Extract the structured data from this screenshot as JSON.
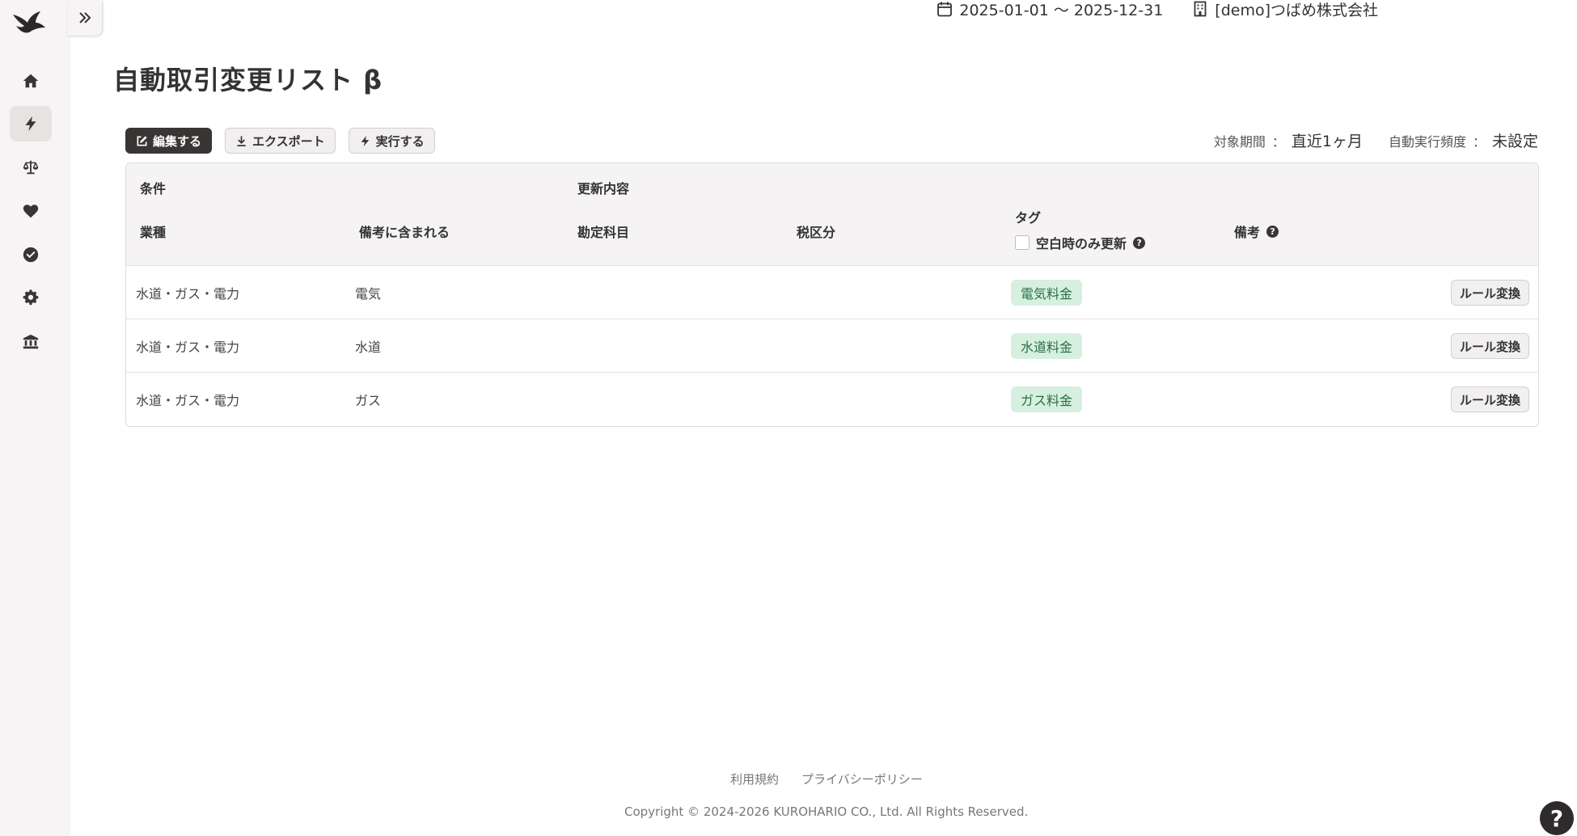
{
  "app": {
    "logo_icon": "swallow-bird-logo"
  },
  "sidebar": {
    "items": [
      {
        "name": "home",
        "icon": "home-icon",
        "active": false
      },
      {
        "name": "auto-rules",
        "icon": "lightning-icon",
        "active": true
      },
      {
        "name": "balance",
        "icon": "scale-icon",
        "active": false
      },
      {
        "name": "favorites",
        "icon": "heart-icon",
        "active": false
      },
      {
        "name": "check",
        "icon": "check-circle-icon",
        "active": false
      },
      {
        "name": "settings",
        "icon": "gear-icon",
        "active": false
      },
      {
        "name": "bank",
        "icon": "bank-icon",
        "active": false
      }
    ],
    "expand_icon": "double-chevron-right-icon"
  },
  "topbar": {
    "period": "2025-01-01 〜 2025-12-31",
    "company": "[demo]つばめ株式会社"
  },
  "page": {
    "title": "自動取引変更リスト β"
  },
  "toolbar": {
    "edit_label": "編集する",
    "export_label": "エクスポート",
    "run_label": "実行する"
  },
  "settings": {
    "period_label": "対象期間",
    "period_value": "直近1ヶ月",
    "frequency_label": "自動実行頻度",
    "frequency_value": "未設定",
    "separator": "："
  },
  "table": {
    "group_condition": "条件",
    "group_update": "更新内容",
    "col_industry": "業種",
    "col_remark_contains": "備考に含まれる",
    "col_account": "勘定科目",
    "col_tax": "税区分",
    "col_tag": "タグ",
    "col_tag_option": "空白時のみ更新",
    "col_remark": "備考",
    "rows": [
      {
        "industry": "水道・ガス・電力",
        "remark_contains": "電気",
        "account": "",
        "tax": "",
        "tag": "電気料金",
        "remark": "",
        "action": "ルール変換"
      },
      {
        "industry": "水道・ガス・電力",
        "remark_contains": "水道",
        "account": "",
        "tax": "",
        "tag": "水道料金",
        "remark": "",
        "action": "ルール変換"
      },
      {
        "industry": "水道・ガス・電力",
        "remark_contains": "ガス",
        "account": "",
        "tax": "",
        "tag": "ガス料金",
        "remark": "",
        "action": "ルール変換"
      }
    ]
  },
  "footer": {
    "terms": "利用規約",
    "privacy": "プライバシーポリシー",
    "copyright": "Copyright © 2024-2026 KUROHARIO CO., Ltd. All Rights Reserved.",
    "help_glyph": "?"
  },
  "colors": {
    "sidebar_bg": "#f6f4f4",
    "primary_dark": "#3a3535",
    "tag_bg": "#d6f0df",
    "tag_text": "#2b6b44"
  }
}
